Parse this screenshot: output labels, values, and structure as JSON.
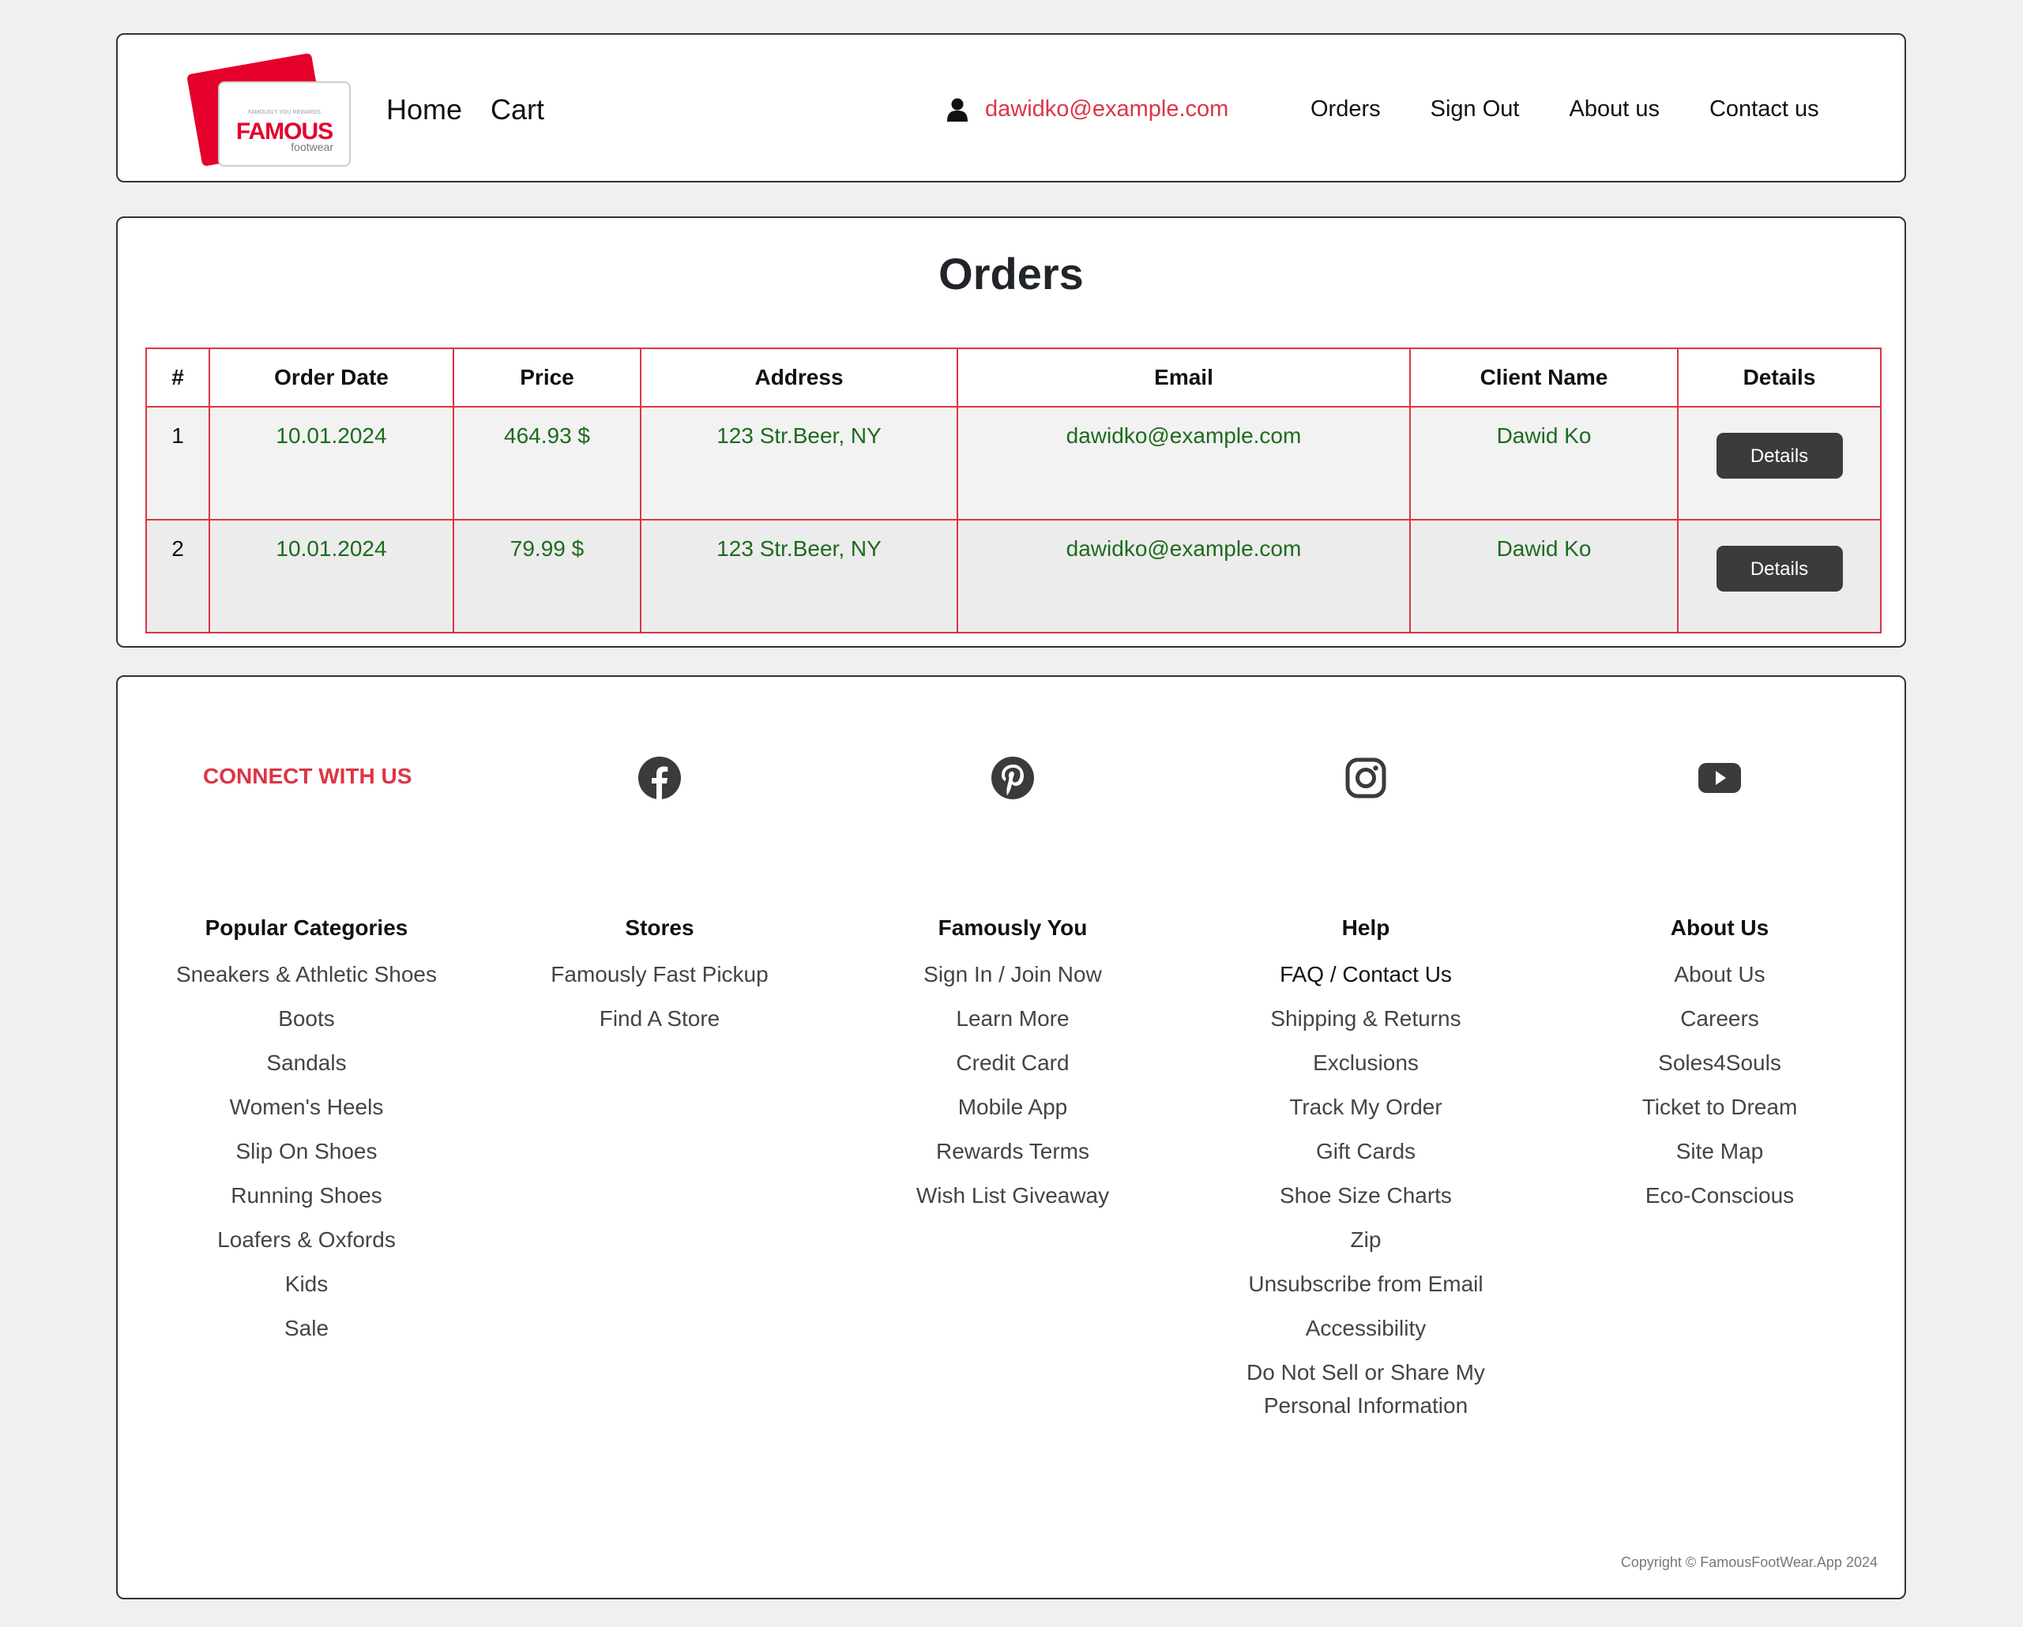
{
  "header": {
    "logo": {
      "tagline": "FAMOUSLY YOU REWARDS",
      "brand": "FAMOUS",
      "sub": "footwear"
    },
    "nav_main": [
      "Home",
      "Cart"
    ],
    "user_email": "dawidko@example.com",
    "nav_right": [
      "Orders",
      "Sign Out",
      "About us",
      "Contact us"
    ]
  },
  "orders": {
    "title": "Orders",
    "columns": [
      "#",
      "Order Date",
      "Price",
      "Address",
      "Email",
      "Client Name",
      "Details"
    ],
    "rows": [
      {
        "index": "1",
        "date": "10.01.2024",
        "price": "464.93 $",
        "address": "123 Str.Beer, NY",
        "email": "dawidko@example.com",
        "client": "Dawid Ko",
        "button": "Details"
      },
      {
        "index": "2",
        "date": "10.01.2024",
        "price": "79.99 $",
        "address": "123 Str.Beer, NY",
        "email": "dawidko@example.com",
        "client": "Dawid Ko",
        "button": "Details"
      }
    ]
  },
  "footer": {
    "connect_label": "CONNECT WITH US",
    "social_icons": [
      "facebook-icon",
      "pinterest-icon",
      "instagram-icon",
      "youtube-icon"
    ],
    "columns": [
      {
        "title": "Popular Categories",
        "links": [
          "Sneakers & Athletic Shoes",
          "Boots",
          "Sandals",
          "Women's Heels",
          "Slip On Shoes",
          "Running Shoes",
          "Loafers & Oxfords",
          "Kids",
          "Sale"
        ]
      },
      {
        "title": "Stores",
        "links": [
          "Famously Fast Pickup",
          "Find A Store"
        ]
      },
      {
        "title": "Famously You",
        "links": [
          "Sign In / Join Now",
          "Learn More",
          "Credit Card",
          "Mobile App",
          "Rewards Terms",
          "Wish List Giveaway"
        ]
      },
      {
        "title": "Help",
        "links": [
          "FAQ / Contact Us",
          "Shipping & Returns",
          "Exclusions",
          "Track My Order",
          "Gift Cards",
          "Shoe Size Charts",
          "Zip",
          "Unsubscribe from Email",
          "Accessibility",
          "Do Not Sell or Share My Personal Information"
        ]
      },
      {
        "title": "About Us",
        "links": [
          "About Us",
          "Careers",
          "Soles4Souls",
          "Ticket to Dream",
          "Site Map",
          "Eco-Conscious"
        ]
      }
    ],
    "copyright": "Copyright © FamousFootWear.App 2024"
  },
  "colors": {
    "accent": "#dc3545",
    "table_text": "#1d6b1d",
    "button": "#3b3b3b",
    "icon": "#3b3b3b"
  }
}
